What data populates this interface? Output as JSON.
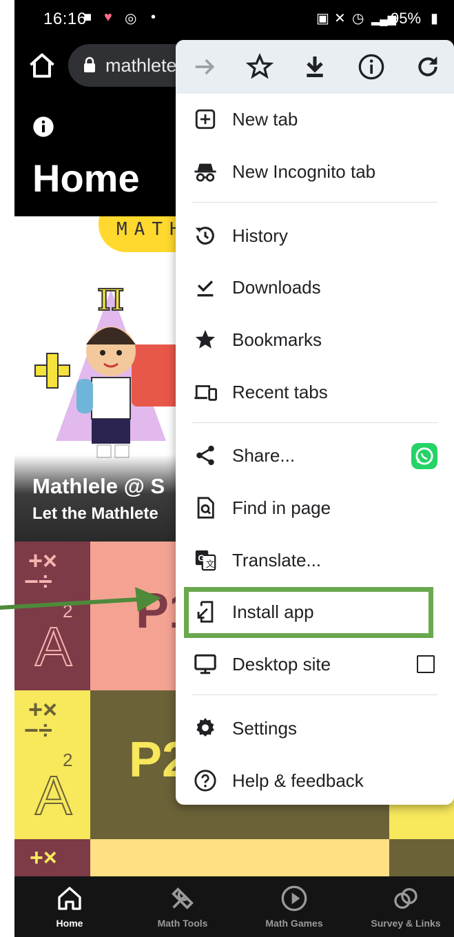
{
  "status_bar": {
    "time": "16:16",
    "battery": "95%"
  },
  "browser": {
    "url": "mathlete"
  },
  "page": {
    "title": "Home",
    "badge_text": "MATH",
    "hero_title": "Mathlele @ S",
    "hero_subtitle": "Let the Mathlete",
    "tiles": [
      {
        "label": "P1",
        "color": "#f4a393",
        "side_color": "#7c3b47"
      },
      {
        "label": "P2",
        "color": "#6b6238",
        "side_color": "#f7e85c"
      }
    ]
  },
  "bottom_nav": {
    "items": [
      {
        "label": "Home",
        "icon": "home-icon",
        "active": true
      },
      {
        "label": "Math Tools",
        "icon": "tools-icon",
        "active": false
      },
      {
        "label": "Math Games",
        "icon": "play-icon",
        "active": false
      },
      {
        "label": "Survey & Links",
        "icon": "link-icon",
        "active": false
      }
    ]
  },
  "menu": {
    "toolbar": [
      "forward-icon",
      "star-icon",
      "download-icon",
      "info-icon",
      "refresh-icon"
    ],
    "items": [
      {
        "label": "New tab",
        "icon": "new-tab-icon"
      },
      {
        "label": "New Incognito tab",
        "icon": "incognito-icon"
      },
      {
        "label": "History",
        "icon": "history-icon"
      },
      {
        "label": "Downloads",
        "icon": "downloads-icon"
      },
      {
        "label": "Bookmarks",
        "icon": "bookmark-star-icon"
      },
      {
        "label": "Recent tabs",
        "icon": "devices-icon"
      },
      {
        "label": "Share...",
        "icon": "share-icon"
      },
      {
        "label": "Find in page",
        "icon": "find-in-page-icon"
      },
      {
        "label": "Translate...",
        "icon": "translate-icon"
      },
      {
        "label": "Install app",
        "icon": "install-app-icon"
      },
      {
        "label": "Desktop site",
        "icon": "desktop-icon"
      },
      {
        "label": "Settings",
        "icon": "gear-icon"
      },
      {
        "label": "Help & feedback",
        "icon": "help-icon"
      }
    ],
    "desktop_site_checked": false
  },
  "colors": {
    "highlight": "#6aa84f",
    "arrow": "#4e8a3a",
    "whatsapp": "#25d366"
  }
}
